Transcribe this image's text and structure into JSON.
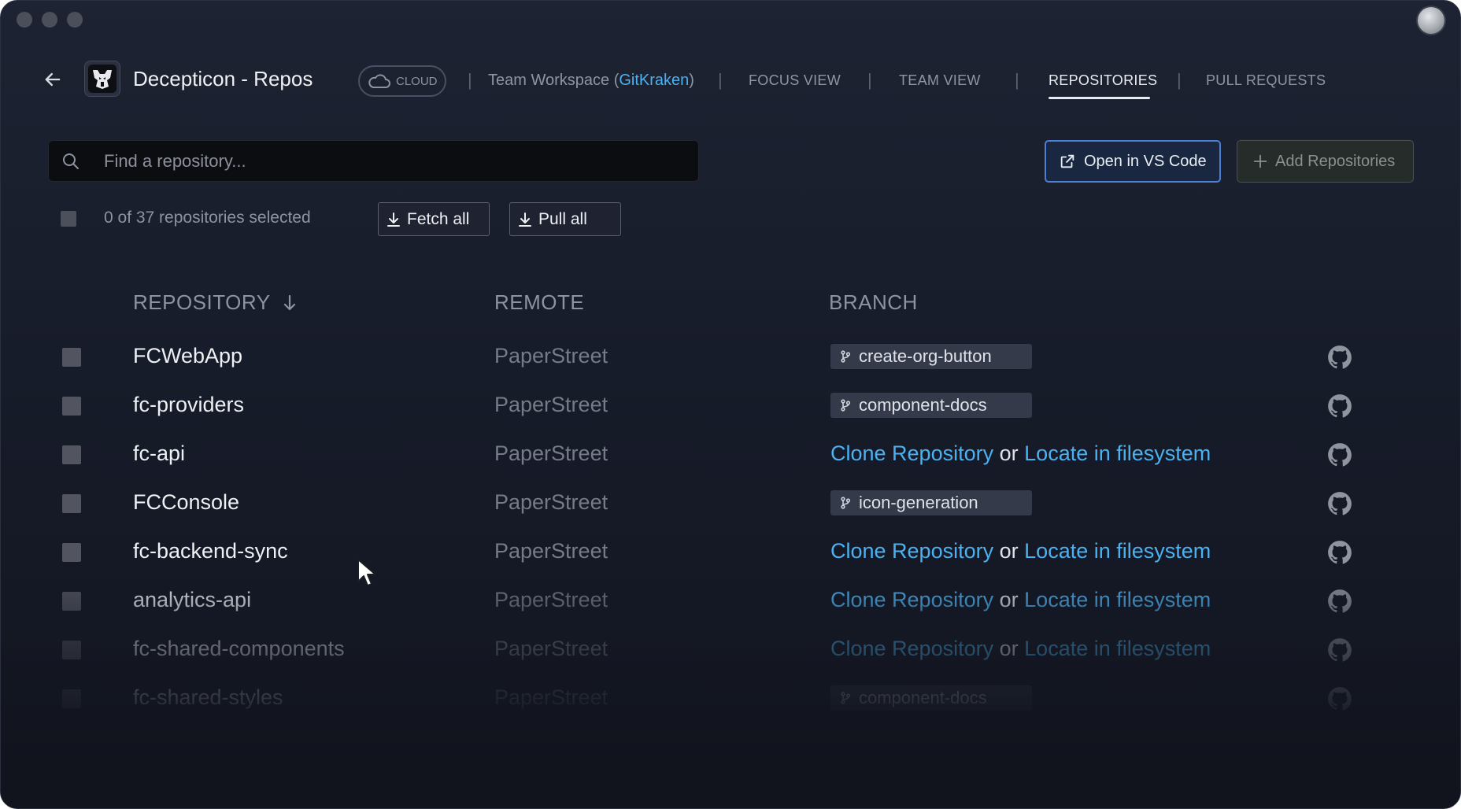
{
  "header": {
    "workspace_title": "Decepticon - Repos",
    "cloud_label": "CLOUD",
    "team_prefix": "Team Workspace (",
    "team_link": "GitKraken",
    "team_suffix": ")",
    "nav": [
      {
        "label": "FOCUS VIEW",
        "active": false
      },
      {
        "label": "TEAM VIEW",
        "active": false
      },
      {
        "label": "REPOSITORIES",
        "active": true
      },
      {
        "label": "PULL REQUESTS",
        "active": false
      }
    ]
  },
  "search": {
    "placeholder": "Find a repository..."
  },
  "actions": {
    "open_vscode": "Open in VS Code",
    "add_repos": "Add Repositories"
  },
  "toolbar": {
    "selected_count": "0 of 37 repositories selected",
    "fetch_all": "Fetch all",
    "pull_all": "Pull all"
  },
  "table": {
    "columns": {
      "repository": "REPOSITORY",
      "remote": "REMOTE",
      "branch": "BRANCH"
    },
    "clone_label": "Clone Repository",
    "or_label": "or",
    "locate_label": "Locate in filesystem",
    "rows": [
      {
        "name": "FCWebApp",
        "remote": "PaperStreet",
        "branch": "create-org-button"
      },
      {
        "name": "fc-providers",
        "remote": "PaperStreet",
        "branch": "component-docs"
      },
      {
        "name": "fc-api",
        "remote": "PaperStreet",
        "branch": null
      },
      {
        "name": "FCConsole",
        "remote": "PaperStreet",
        "branch": "icon-generation"
      },
      {
        "name": "fc-backend-sync",
        "remote": "PaperStreet",
        "branch": null
      },
      {
        "name": "analytics-api",
        "remote": "PaperStreet",
        "branch": null
      },
      {
        "name": "fc-shared-components",
        "remote": "PaperStreet",
        "branch": null
      },
      {
        "name": "fc-shared-styles",
        "remote": "PaperStreet",
        "branch": "component-docs"
      }
    ]
  },
  "colors": {
    "accent_link": "#4cb1f0",
    "vscode_border": "#4e7fd6",
    "background": "#1b2030"
  }
}
